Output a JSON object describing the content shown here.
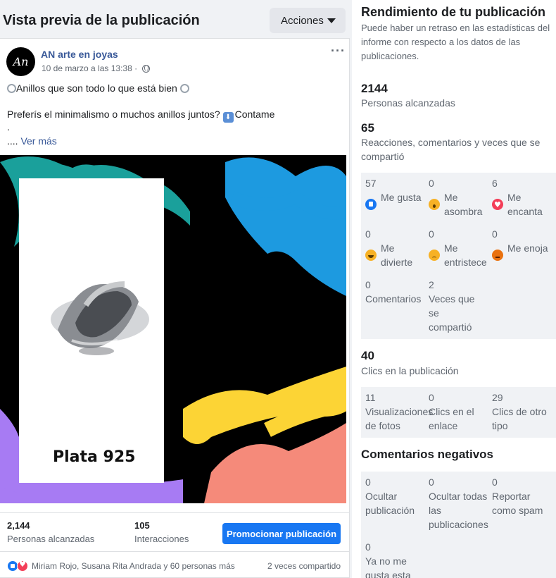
{
  "preview": {
    "title": "Vista previa de la publicación",
    "actions_label": "Acciones"
  },
  "post": {
    "avatar_text": "An",
    "page_name": "AN arte en joyas",
    "date": "10 de marzo a las 13:38 · ",
    "line1": "Anillos que son todo lo que está bien",
    "line2": "Preferís el minimalismo o muchos anillos juntos?",
    "line2_end": "Contame",
    "line3": ".",
    "ellipsis": "....",
    "see_more": "Ver más",
    "image_caption": "Plata 925",
    "reach_value": "2,144",
    "reach_label": "Personas alcanzadas",
    "interactions_value": "105",
    "interactions_label": "Interacciones",
    "promote_label": "Promocionar publicación",
    "likers": "Miriam Rojo, Susana Rita Andrada y 60 personas más",
    "shares": "2 veces compartido"
  },
  "performance": {
    "title": "Rendimiento de tu publicación",
    "subtitle": "Puede haber un retraso en las estadísticas del informe con respecto a los datos de las publicaciones.",
    "reach_value": "2144",
    "reach_label": "Personas alcanzadas",
    "engagement_value": "65",
    "engagement_label": "Reacciones, comentarios y veces que se compartió",
    "reactions": [
      {
        "value": "57",
        "label": "Me gusta",
        "icon": "like-icon"
      },
      {
        "value": "0",
        "label": "Me asombra",
        "icon": "wow-icon"
      },
      {
        "value": "6",
        "label": "Me encanta",
        "icon": "love-icon"
      },
      {
        "value": "0",
        "label": "Me divierte",
        "icon": "haha-icon"
      },
      {
        "value": "0",
        "label": "Me entristece",
        "icon": "sad-icon"
      },
      {
        "value": "0",
        "label": "Me enoja",
        "icon": "angry-icon"
      }
    ],
    "comments_value": "0",
    "comments_label": "Comentarios",
    "shared_value": "2",
    "shared_label": "Veces que se compartió",
    "clicks_value": "40",
    "clicks_label": "Clics en la publicación",
    "clicks": [
      {
        "value": "11",
        "label": "Visualizaciones de fotos"
      },
      {
        "value": "0",
        "label": "Clics en el enlace"
      },
      {
        "value": "29",
        "label": "Clics de otro tipo"
      }
    ],
    "negative_title": "Comentarios negativos",
    "negative": [
      {
        "value": "0",
        "label": "Ocultar publicación"
      },
      {
        "value": "0",
        "label": "Ocultar todas las publicaciones"
      },
      {
        "value": "0",
        "label": "Reportar como spam"
      },
      {
        "value": "0",
        "label": "Ya no me gusta esta"
      }
    ]
  },
  "colors": {
    "accent": "#1877f2",
    "link": "#385898"
  }
}
